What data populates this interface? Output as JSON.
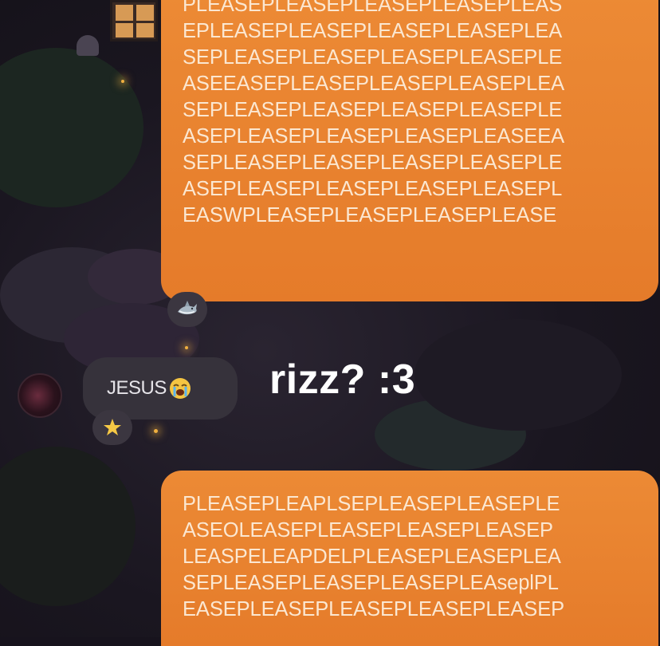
{
  "top_message": {
    "lines": [
      "PLEASEPLEASEPLEASEPLEASEPLEAS",
      "EPLEASEPLEASEPLEASEPLEASEPLEA",
      "SEPLEASEPLEASEPLEASEPLEASEPLE",
      "ASEEASEPLEASEPLEASEPLEASEPLEA",
      "SEPLEASEPLEASEPLEASEPLEASEPLE",
      "ASEPLEASEPLEASEPLEASEPLEASEEA",
      "SEPLEASEPLEASEPLEASEPLEASEPLE",
      "ASEPLEASEPLEASEPLEASEPLEASEPL",
      "EASWPLEASEPLEASEPLEASEPLEASE"
    ],
    "reaction_icon": "shark-icon"
  },
  "reply": {
    "text": "JESUS",
    "emoji_icon": "crying-face-icon",
    "reaction_icon": "star-icon"
  },
  "caption": "rizz? :3",
  "bottom_message": {
    "lines": [
      "PLEASEPLEAPLSEPLEASEPLEASEPLE",
      "ASEOLEASEPLEASEPLEASEPLEASEP",
      "LEASPELEAPDELPLEASEPLEASEPLEA",
      "SEPLEASEPLEASEPLEASEPLEAseplPL",
      "EASEPLEASEPLEASEPLEASEPLEASEP"
    ]
  },
  "colors": {
    "bubble_orange": "#e98431",
    "bubble_text": "#fbe7d1",
    "reply_bubble": "#36323b",
    "background": "#17131d"
  }
}
